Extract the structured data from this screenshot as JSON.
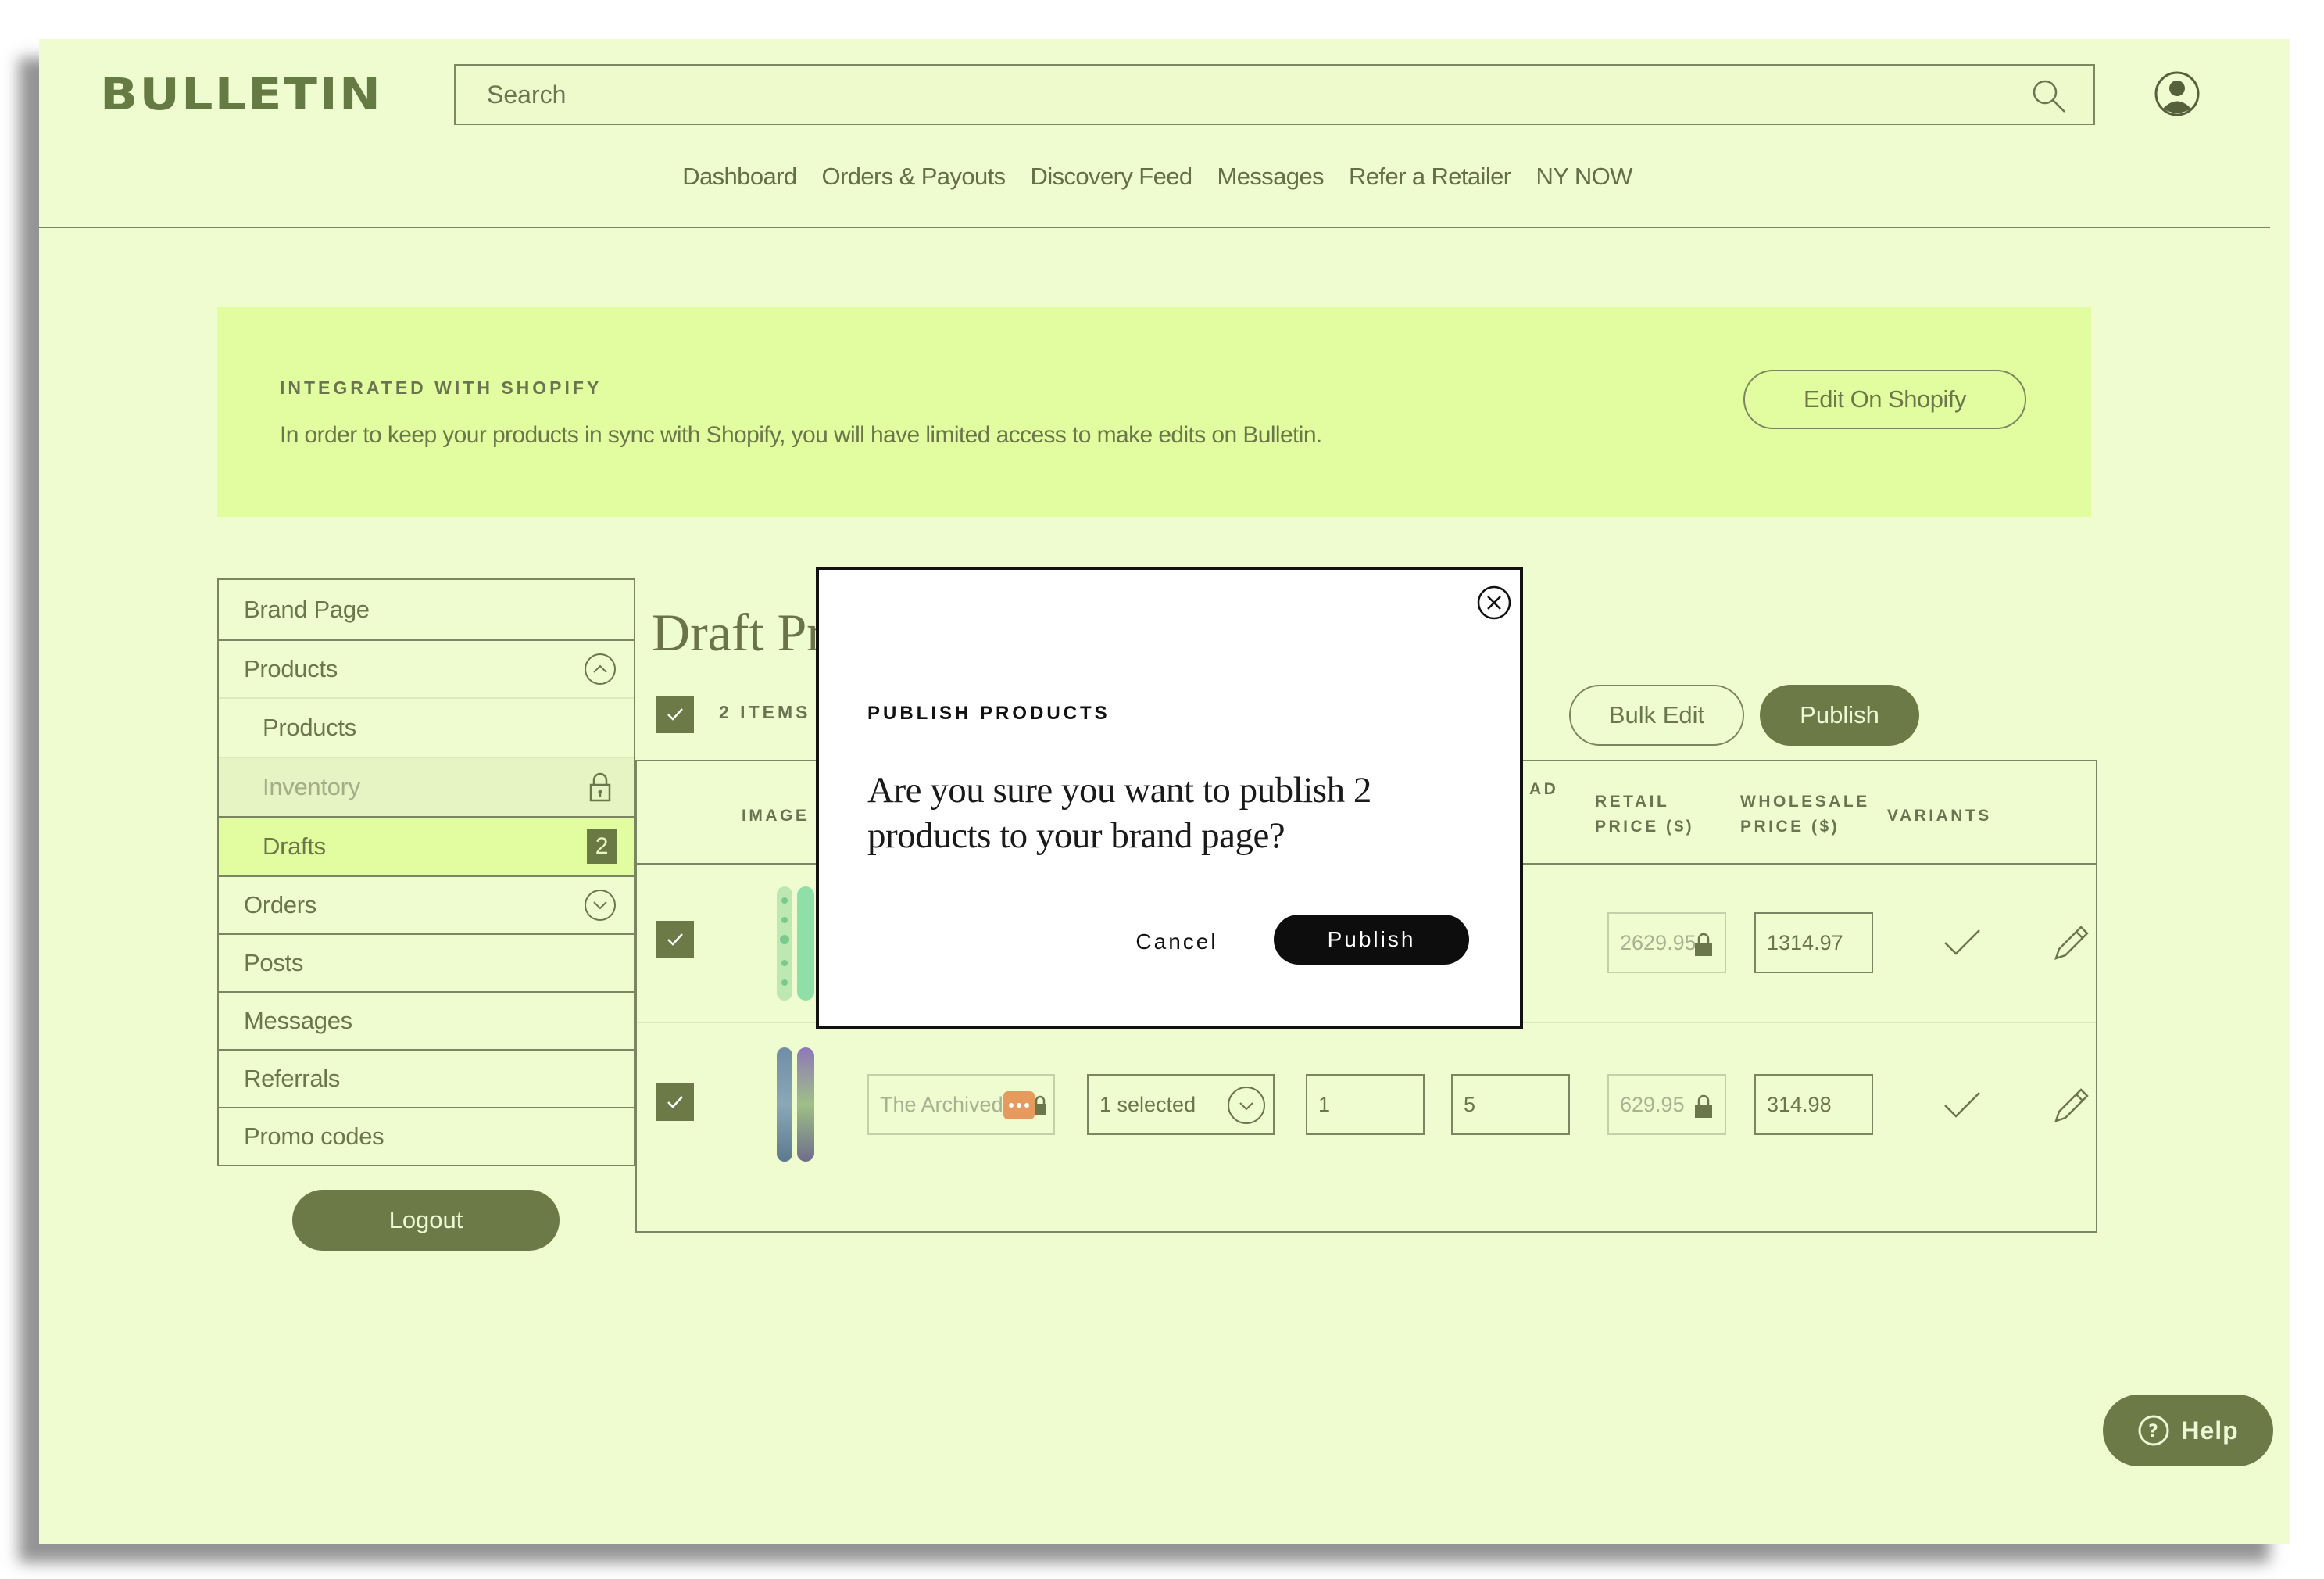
{
  "header": {
    "logo": "BULLETIN",
    "search_placeholder": "Search",
    "nav": [
      "Dashboard",
      "Orders & Payouts",
      "Discovery Feed",
      "Messages",
      "Refer a Retailer",
      "NY NOW"
    ]
  },
  "banner": {
    "title": "INTEGRATED WITH SHOPIFY",
    "text": "In order to keep your products in sync with Shopify, you will have limited access to make edits on Bulletin.",
    "button": "Edit On Shopify"
  },
  "sidebar": {
    "brand_page": "Brand Page",
    "products": "Products",
    "sub_products": "Products",
    "inventory": "Inventory",
    "drafts": "Drafts",
    "drafts_count": "2",
    "orders": "Orders",
    "posts": "Posts",
    "messages": "Messages",
    "referrals": "Referrals",
    "promo_codes": "Promo codes",
    "logout": "Logout"
  },
  "main": {
    "title": "Draft Products",
    "items_count": "2 ITEMS",
    "bulk_edit": "Bulk Edit",
    "publish": "Publish",
    "columns": {
      "image": "IMAGE",
      "lead_fragment": "AD",
      "retail_1": "RETAIL",
      "retail_2": "PRICE ($)",
      "wholesale_1": "WHOLESALE",
      "wholesale_2": "PRICE ($)",
      "variants": "VARIANTS"
    },
    "rows": [
      {
        "retail": "2629.95",
        "wholesale": "1314.97"
      },
      {
        "name": "The Archived",
        "category": "1 selected",
        "min_qty": "1",
        "lead_time": "5",
        "retail": "629.95",
        "wholesale": "314.98"
      }
    ]
  },
  "modal": {
    "title": "PUBLISH PRODUCTS",
    "message": "Are you sure you want to publish 2 products to your brand page?",
    "cancel": "Cancel",
    "publish": "Publish"
  },
  "help": {
    "label": "Help"
  },
  "colors": {
    "background": "#effccf",
    "banner": "#e2fd9f",
    "accent": "#6b7a47",
    "modal_button": "#0d0d0d"
  },
  "icons": [
    "search-icon",
    "user-icon",
    "chevron-up-icon",
    "lock-icon",
    "chevron-down-icon",
    "check-icon",
    "pencil-icon",
    "close-icon",
    "help-icon"
  ]
}
